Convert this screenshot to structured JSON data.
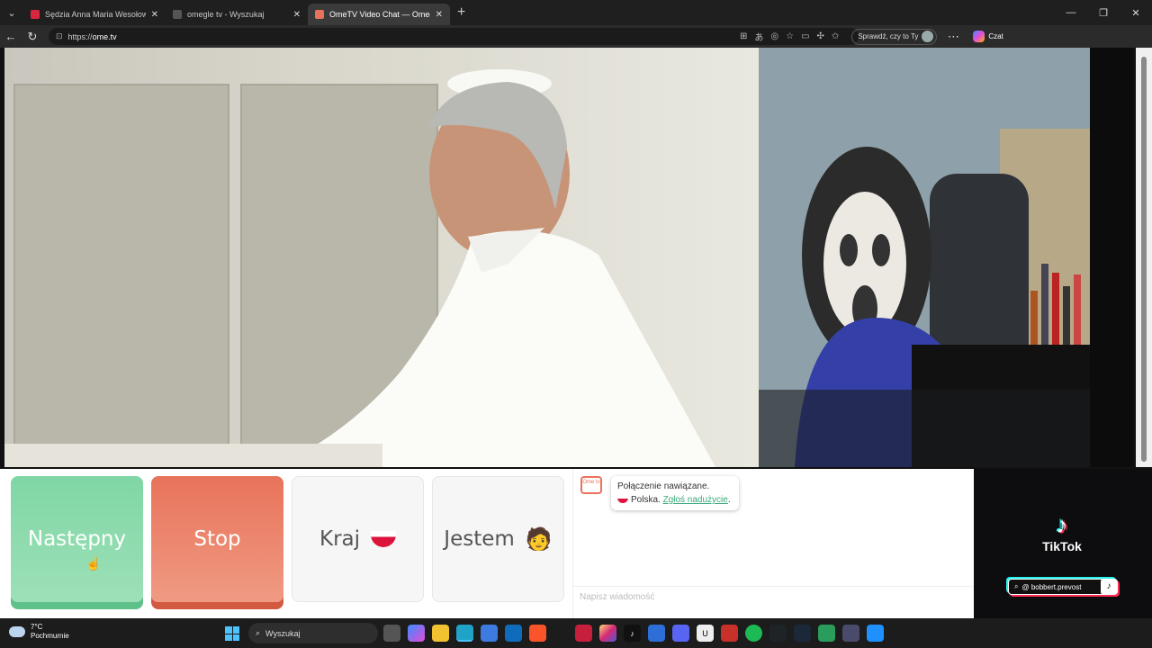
{
  "tabs": [
    {
      "title": "Sędzia Anna Maria Wesołowska o",
      "favicon_color": "#d7263d",
      "active": false
    },
    {
      "title": "omegle tv - Wyszukaj",
      "favicon_color": "#555555",
      "active": false
    },
    {
      "title": "OmeTV Video Chat — Omegle",
      "favicon_color": "#e8735a",
      "active": true
    }
  ],
  "address": {
    "scheme": "https://",
    "host": "ome.tv"
  },
  "profile": {
    "label": "Sprawdź, czy to Ty"
  },
  "copilot": {
    "label": "Czat"
  },
  "controls": {
    "next_label": "Następny",
    "stop_label": "Stop",
    "country_label": "Kraj",
    "gender_label": "Jestem",
    "gender_emoji": "🧑"
  },
  "chat": {
    "logo_text": "Ome tv",
    "connected": "Połączenie nawiązane.",
    "country": "Polska.",
    "report_link": "Zgłoś nadużycie",
    "input_placeholder": "Napisz wiadomość"
  },
  "tiktok": {
    "brand": "TikTok",
    "handle": "@ bobbert.prevost"
  },
  "taskbar": {
    "temperature": "7°C",
    "condition": "Pochmurnie",
    "search_label": "Wyszukaj"
  },
  "colors": {
    "next": "#7fd6a5",
    "stop": "#e8735a",
    "link": "#3aa87a"
  }
}
